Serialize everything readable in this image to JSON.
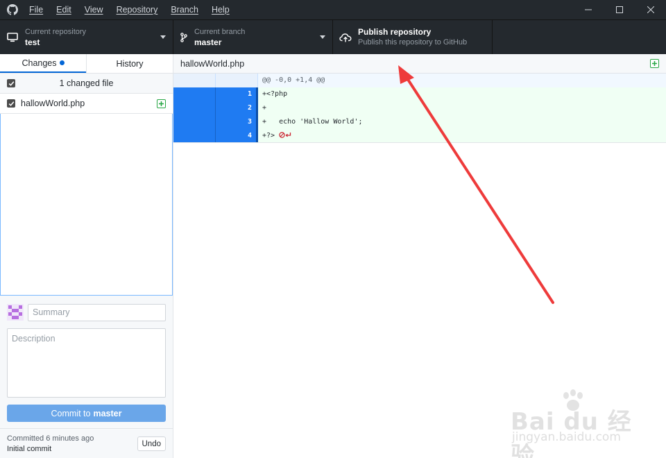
{
  "menu": [
    "File",
    "Edit",
    "View",
    "Repository",
    "Branch",
    "Help"
  ],
  "toolbar": {
    "repo_label": "Current repository",
    "repo_value": "test",
    "branch_label": "Current branch",
    "branch_value": "master",
    "publish_title": "Publish repository",
    "publish_subtitle": "Publish this repository to GitHub"
  },
  "sidebar": {
    "tabs": [
      {
        "label": "Changes",
        "active": true
      },
      {
        "label": "History",
        "active": false
      }
    ],
    "changed_count": "1 changed file",
    "files": [
      {
        "name": "hallowWorld.php",
        "status": "added"
      }
    ]
  },
  "commit": {
    "summary_placeholder": "Summary",
    "description_placeholder": "Description",
    "button_prefix": "Commit to",
    "button_branch": "master"
  },
  "last_commit": {
    "time": "Committed 6 minutes ago",
    "message": "Initial commit",
    "undo_label": "Undo"
  },
  "diff": {
    "filename": "hallowWorld.php",
    "hunk": "@@ -0,0 +1,4 @@",
    "lines": [
      {
        "num": "1",
        "code": "+<?php"
      },
      {
        "num": "2",
        "code": "+"
      },
      {
        "num": "3",
        "code": "+   echo 'Hallow World';"
      },
      {
        "num": "4",
        "code": "+?>"
      }
    ]
  },
  "watermark": {
    "brand": "Bai du 经验",
    "url": "jingyan.baidu.com"
  },
  "colors": {
    "titlebar": "#24292e",
    "accent": "#0366d6",
    "selected_gutter": "#1f7bf2",
    "added_bg": "#f0fff4",
    "annotation_arrow": "#ee3b3b"
  }
}
